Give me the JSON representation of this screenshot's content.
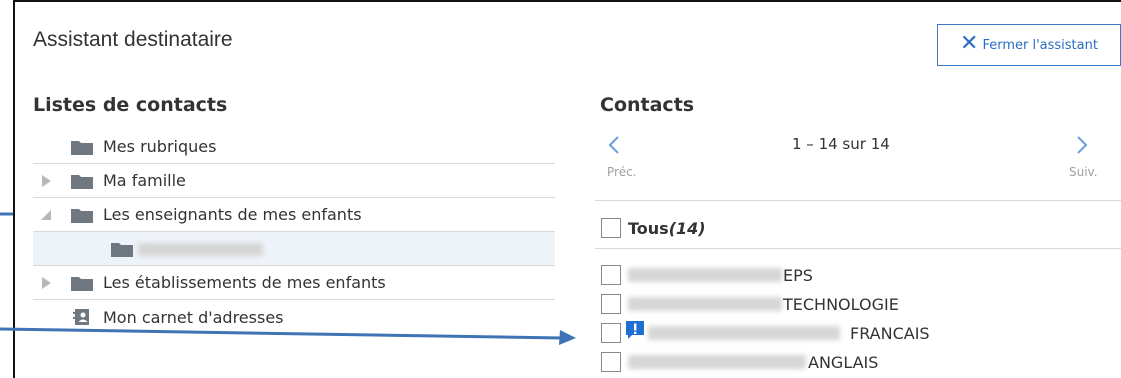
{
  "dialog": {
    "title": "Assistant destinataire",
    "close_label": "Fermer l'assistant"
  },
  "left": {
    "heading": "Listes de contacts",
    "items": [
      {
        "label": "Mes rubriques"
      },
      {
        "label": "Ma famille"
      },
      {
        "label": "Les enseignants de mes enfants"
      },
      {
        "label": ""
      },
      {
        "label": "Les établissements de mes enfants"
      },
      {
        "label": "Mon carnet d'adresses"
      }
    ]
  },
  "right": {
    "heading": "Contacts",
    "pager": {
      "range": "1 – 14 sur 14",
      "prev": "Préc.",
      "next": "Suiv."
    },
    "all_label": "Tous(14)",
    "contacts": [
      {
        "subject": "EPS"
      },
      {
        "subject": "TECHNOLOGIE"
      },
      {
        "subject": "FRANCAIS"
      },
      {
        "subject": "ANGLAIS"
      }
    ]
  },
  "colors": {
    "accent": "#2b6cc4",
    "arrow": "#3e73b5",
    "selected_row": "#eef3f9",
    "folder": "#6f7880",
    "border": "#d8d8d8"
  }
}
